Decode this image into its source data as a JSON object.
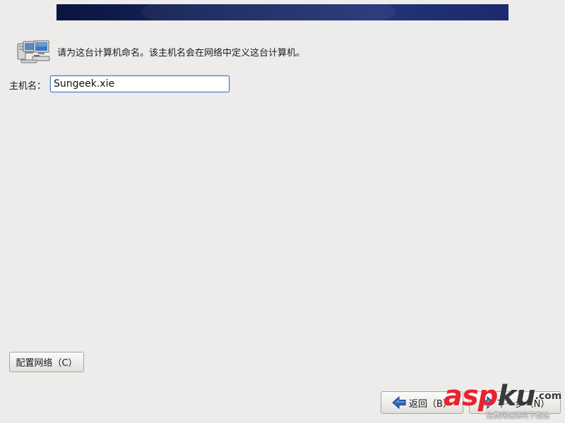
{
  "intro": {
    "icon": "network-computers-icon",
    "text": "请为这台计算机命名。该主机名会在网络中定义这台计算机。"
  },
  "hostname": {
    "label": "主机名：",
    "value": "Sungeek.xie"
  },
  "buttons": {
    "configure_network": "配置网络（C）",
    "back": "返回（B）",
    "back_icon": "arrow-left-icon",
    "next": "下一步（N）",
    "next_icon": "arrow-right-icon"
  },
  "watermark": {
    "logo_a": "asp",
    "logo_b": "ku",
    "logo_c": ".com",
    "sub": "免费网站源码下载站"
  },
  "colors": {
    "background": "#edeceb",
    "banner": "#1a2a66",
    "input_focus_border": "#4f7fcc",
    "watermark_red": "#e8232d"
  }
}
